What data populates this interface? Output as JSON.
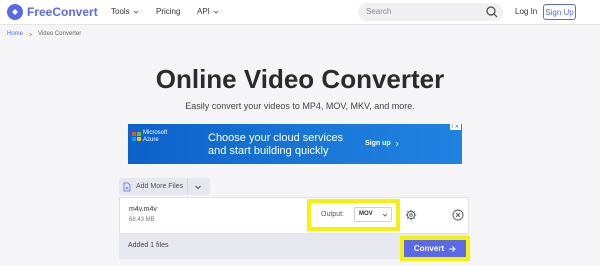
{
  "header": {
    "logo_text": "FreeConvert",
    "nav": [
      {
        "label": "Tools"
      },
      {
        "label": "Pricing"
      },
      {
        "label": "API"
      }
    ],
    "search": {
      "placeholder": "Search"
    },
    "login": "Log In",
    "signup": "Sign Up"
  },
  "breadcrumb": {
    "home": "Home",
    "current": "Video Converter"
  },
  "main": {
    "title": "Online Video Converter",
    "subtitle": "Easily convert your videos to MP4, MOV, MKV, and more."
  },
  "ad": {
    "brand_line1": "Microsoft",
    "brand_line2": "Azure",
    "headline_line1": "Choose your cloud services",
    "headline_line2": "and start building quickly",
    "cta": "Sign up",
    "badge": "i ✕"
  },
  "converter": {
    "add_more": "Add More Files",
    "file": {
      "name": "m4v.m4v",
      "size": "68.43 MB"
    },
    "output_label": "Output:",
    "output_value": "MOV",
    "status": "Added 1 files",
    "convert": "Convert"
  },
  "colors": {
    "accent": "#5a69e6",
    "highlight": "#f5f00c",
    "ad_blue": "#0b62c9"
  }
}
